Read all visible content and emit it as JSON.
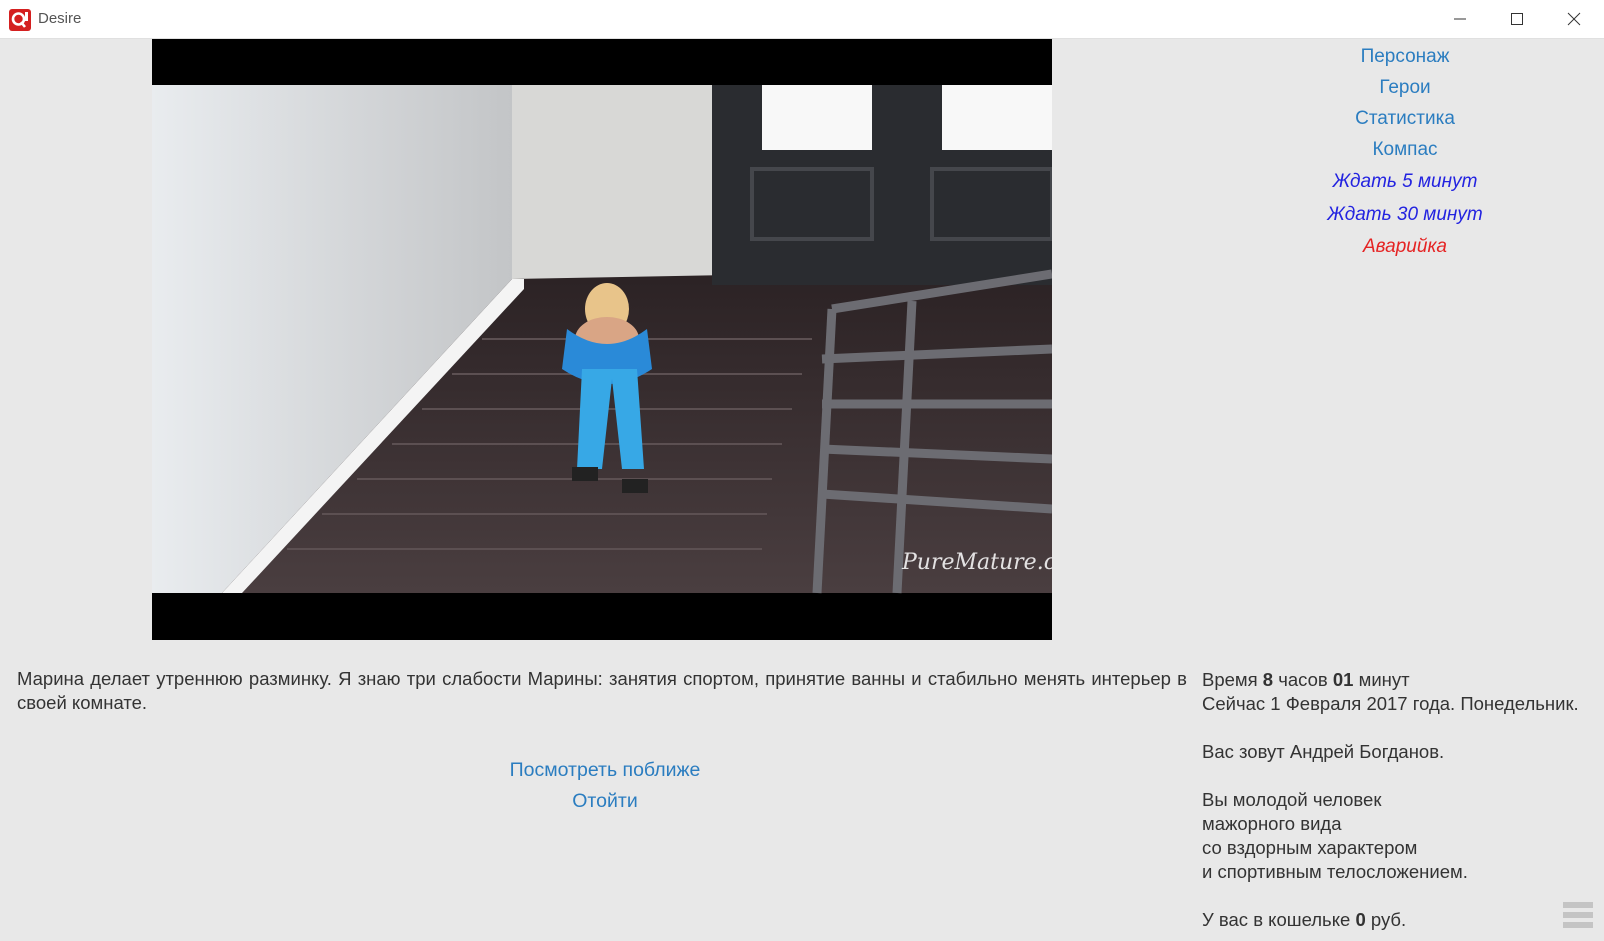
{
  "window": {
    "title": "Desire",
    "icon": "quest-app-icon"
  },
  "menu": {
    "items": [
      {
        "label": "Персонаж"
      },
      {
        "label": "Герои"
      },
      {
        "label": "Статистика"
      },
      {
        "label": "Компас"
      }
    ],
    "wait_5": "Ждать 5 минут",
    "wait_30": "Ждать 30 минут",
    "emergency": "Аварийка"
  },
  "image": {
    "watermark": "PureMature.com"
  },
  "description": "Марина делает утреннюю разминку. Я знаю три слабости Марины: занятия спортом, принятие ванны и стабильно менять интерьер в своей комнате.",
  "actions": [
    {
      "label": "Посмотреть поближе"
    },
    {
      "label": "Отойти"
    }
  ],
  "status": {
    "time_prefix": "Время",
    "hours": "8",
    "hours_word": "часов",
    "minutes": "01",
    "minutes_word": "минут",
    "date_line": "Сейчас 1 Февраля 2017 года. Понедельник.",
    "name_line": "Вас зовут Андрей Богданов.",
    "desc_lines": [
      "Вы молодой человек",
      "мажорного вида",
      "со вздорным характером",
      "и спортивным телосложением."
    ],
    "wallet_prefix": "У вас в кошельке",
    "wallet_amount": "0",
    "wallet_currency": "руб."
  },
  "colors": {
    "link": "#2b7dc0",
    "wait_link": "#2323e0",
    "emergency_link": "#e52424",
    "background": "#e8e8e8"
  }
}
